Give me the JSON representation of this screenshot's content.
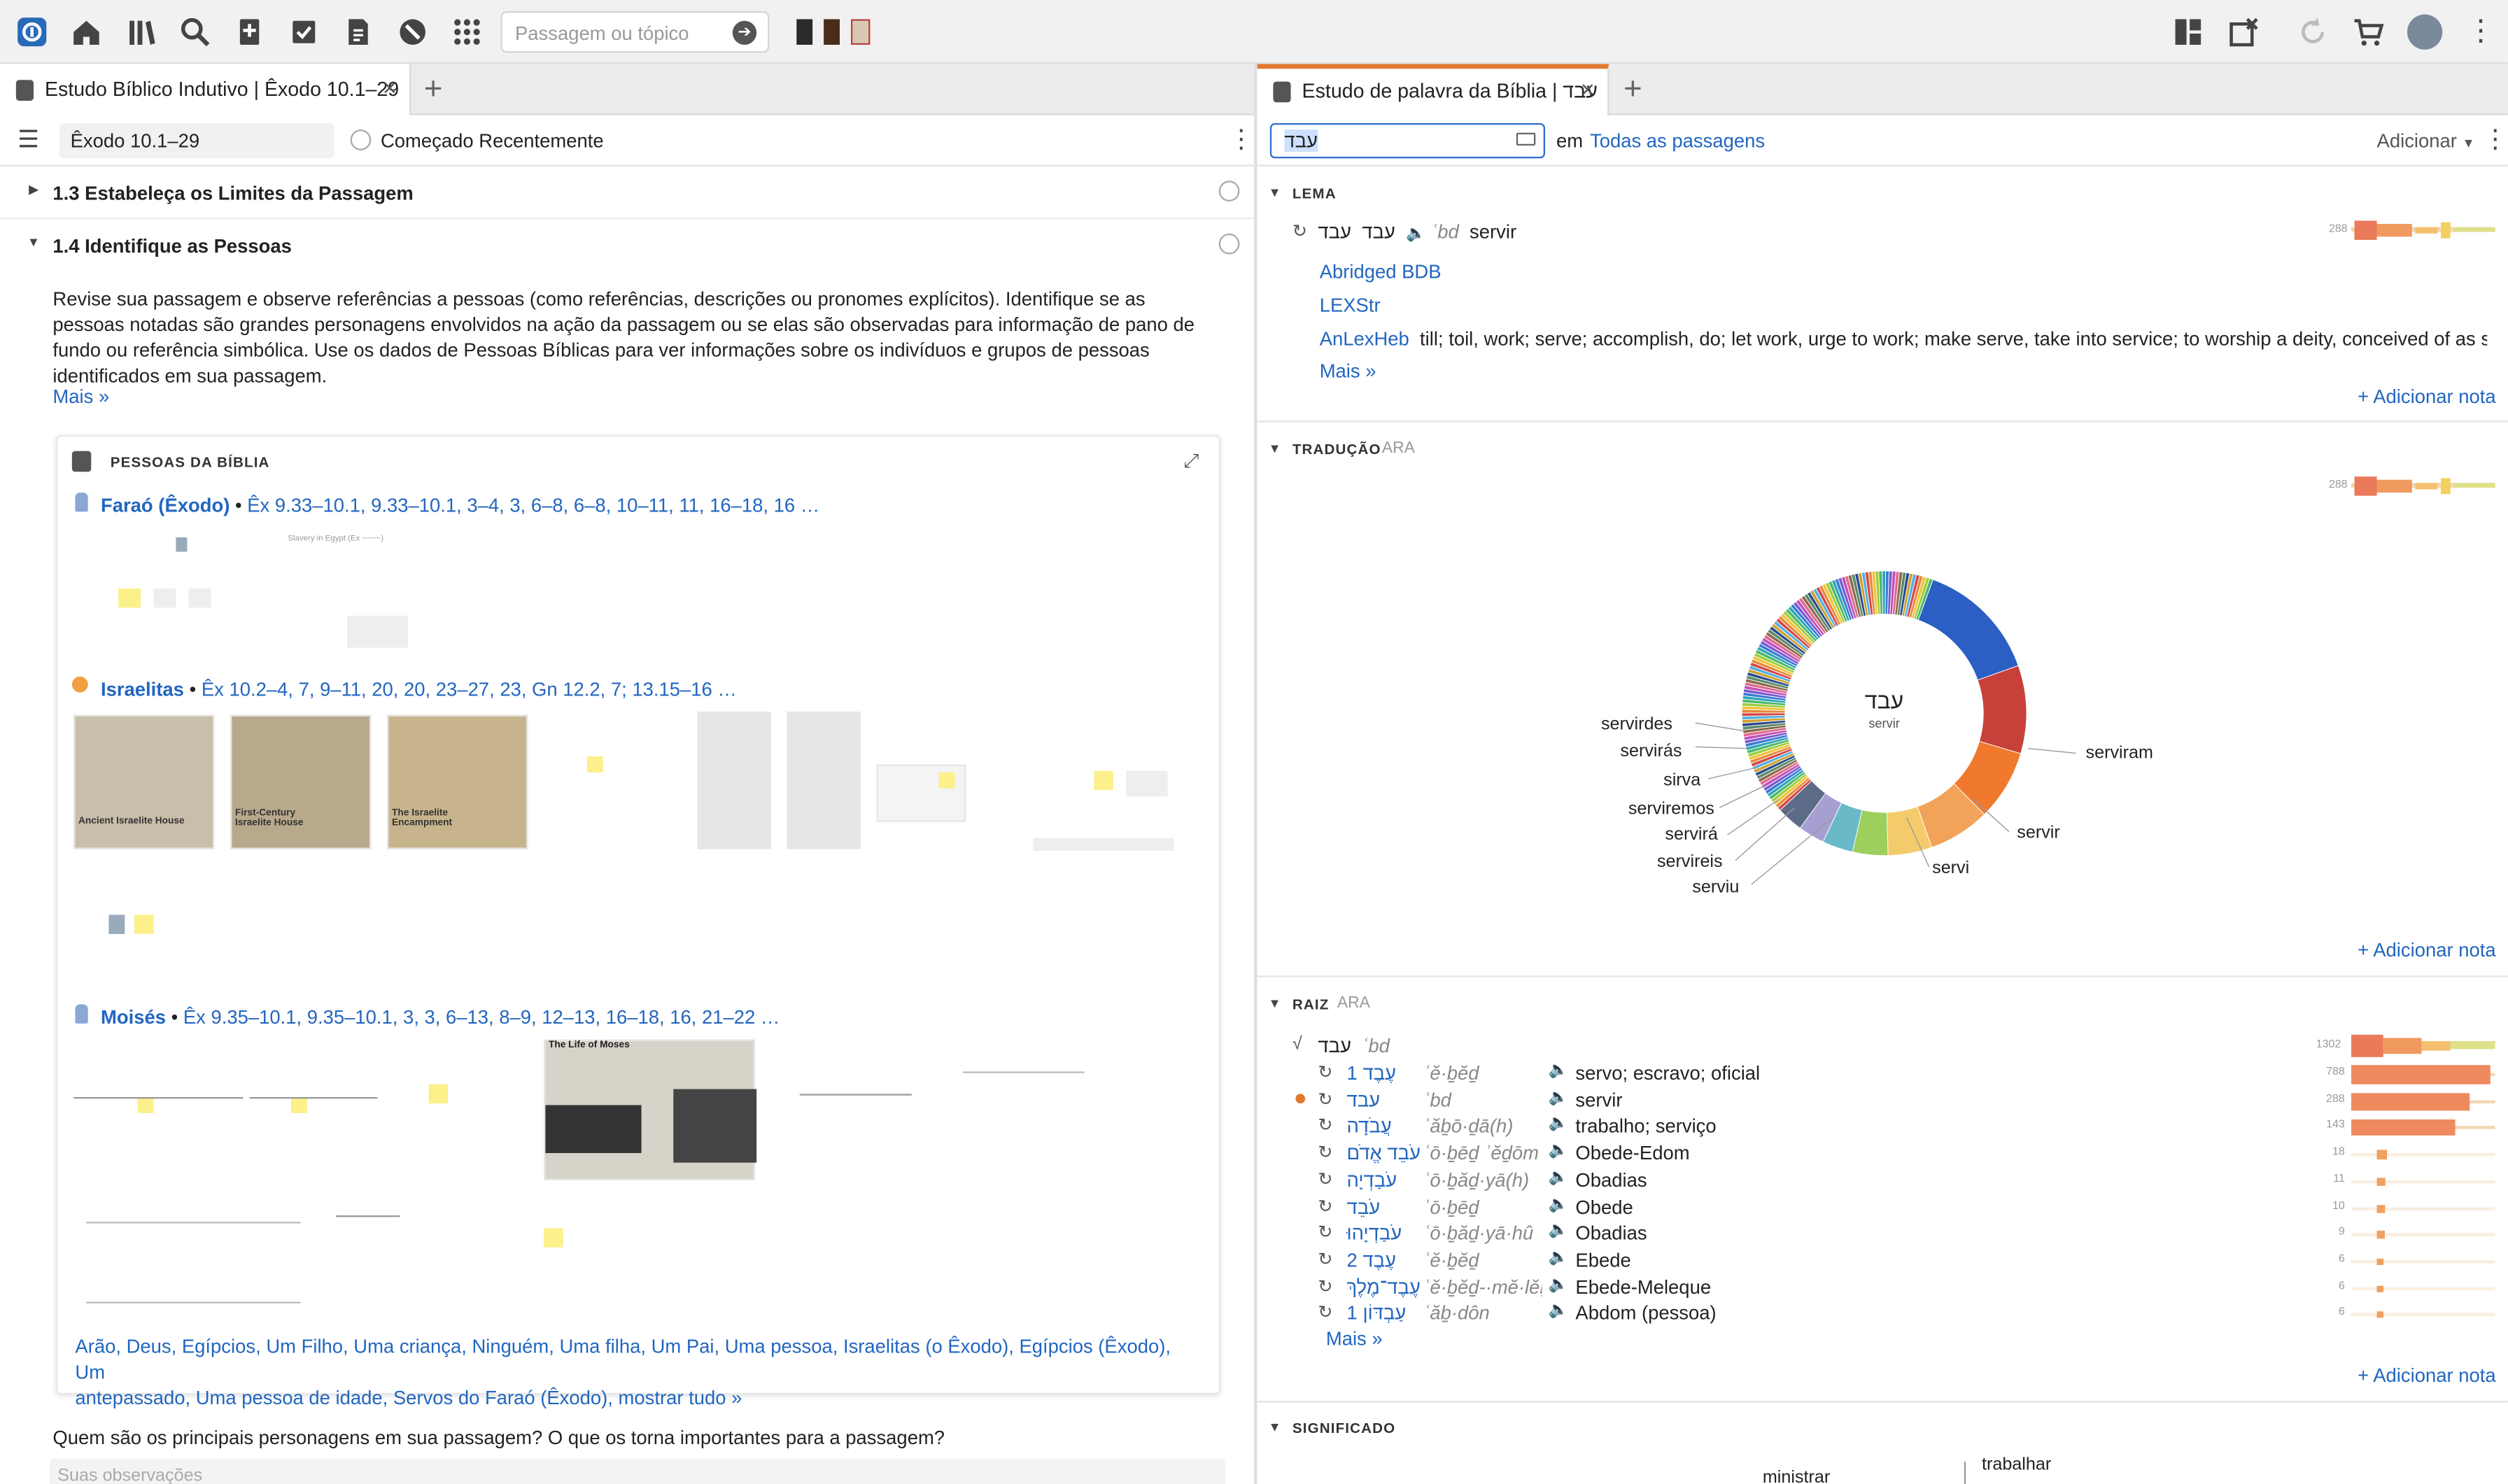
{
  "topbar": {
    "search_placeholder": "Passagem ou tópico"
  },
  "left": {
    "tab_title": "Estudo Bíblico Indutivo | Êxodo 10.1–29",
    "passage": "Êxodo 10.1–29",
    "status": "Começado Recentemente",
    "section_13": "1.3 Estabeleça os Limites da Passagem",
    "section_14": "1.4 Identifique as Pessoas",
    "instructions": "Revise sua passagem e observe referências a pessoas (como referências, descrições ou pronomes explícitos). Identifique se as pessoas notadas são grandes personagens envolvidos na ação da passagem ou se elas são observadas para informação de pano de fundo ou referência simbólica. Use os dados de Pessoas Bíblicas para ver informações sobre os indivíduos e grupos de pessoas identificados em sua passagem.",
    "more": "Mais »",
    "people_title": "PESSOAS DA BÍBLIA",
    "farao_name": "Faraó (Êxodo)",
    "farao_refs": "Êx 9.33–10.1, 9.33–10.1, 3–4, 3, 6–8, 6–8, 10–11, 11, 16–18, 16 …",
    "isr_name": "Israelitas",
    "isr_refs": "Êx 10.2–4, 7, 9–11, 20, 20, 23–27, 23, Gn 12.2, 7; 13.15–16 …",
    "mois_name": "Moisés",
    "mois_refs": "Êx 9.35–10.1, 9.35–10.1, 3, 3, 6–13, 8–9, 12–13, 16–18, 16, 21–22 …",
    "thumb_ancient": "Ancient Israelite House",
    "thumb_first": "First-Century Israelite House",
    "thumb_encamp": "The Israelite Encampment",
    "thumb_slavery": "Slavery in Egypt (Ex ~~~~)",
    "thumb_moses": "The Life of Moses",
    "people_list_1": "Arão, Deus, Egípcios, Um Filho, Uma criança, Ninguém, Uma filha, Um Pai, Uma pessoa, Israelitas (o Êxodo), Egípcios (Êxodo), Um",
    "people_list_2a": "antepassado, Uma pessoa de idade, Servos do Faraó (Êxodo), ",
    "people_list_2b": "mostrar tudo »",
    "question": "Quem são os principais personagens em sua passagem? O que os torna importantes para a passagem?",
    "observations_placeholder": "Suas observações"
  },
  "right": {
    "tab_title": "Estudo de palavra da Bíblia | עבד",
    "query": "עבד",
    "in_label": "em",
    "scope": "Todas as passagens",
    "add": "Adicionar",
    "lema_title": "LEMA",
    "lema_heb1": "עבד",
    "lema_heb2": "עבד",
    "lema_translit": "ʿbd",
    "lema_gloss": "servir",
    "lema_count": "288",
    "res_bdb": "Abridged BDB",
    "res_lexstr": "LEXStr",
    "res_anlex": "AnLexHeb",
    "anlex_def": "till; toil, work; serve; accomplish, do; let work, urge to work; make serve, take into service; to worship a deity, conceived of as servi…",
    "more": "Mais »",
    "add_note": "+ Adicionar nota",
    "trad_title": "TRADUÇÃO",
    "trad_version": "ARA",
    "trad_count": "288",
    "donut_center_word": "עבד",
    "donut_center_gloss": "servir",
    "labels": [
      "servirdes",
      "servirás",
      "sirva",
      "serviremos",
      "servirá",
      "servireis",
      "serviu",
      "servi",
      "servir",
      "serviram"
    ],
    "raiz_title": "RAIZ",
    "raiz_version": "ARA",
    "raiz_heb": "עבד",
    "raiz_translit": "ʿbd",
    "raiz_rows": [
      {
        "heb": "1 עֶבֶד",
        "tr": "ʿĕ·ḇĕḏ",
        "gloss": "servo; escravo; oficial",
        "count": "788"
      },
      {
        "heb": "עבד",
        "tr": "ʿbd",
        "gloss": "servir",
        "count": "288"
      },
      {
        "heb": "עֲבֹדָה",
        "tr": "ʿăḇō·ḏā(h)",
        "gloss": "trabalho; serviço",
        "count": "143"
      },
      {
        "heb": "עֹבֵד אֱדֹם",
        "tr": "ʿō·ḇēḏ ʾĕḏōm",
        "gloss": "Obede-Edom",
        "count": "18"
      },
      {
        "heb": "עֹבַדְיָה",
        "tr": "ʿō·ḇăḏ·yā(h)",
        "gloss": "Obadias",
        "count": "11"
      },
      {
        "heb": "עֹבֵד",
        "tr": "ʿō·ḇēḏ",
        "gloss": "Obede",
        "count": "10"
      },
      {
        "heb": "עֹבַדְיָהוּ",
        "tr": "ʿō·ḇăḏ·yā·hû",
        "gloss": "Obadias",
        "count": "9"
      },
      {
        "heb": "2 עֶבֶד",
        "tr": "ʿĕ·ḇĕḏ",
        "gloss": "Ebede",
        "count": "6"
      },
      {
        "heb": "עֶבֶד־מֶלֶךְ",
        "tr": "ʿĕ·ḇĕḏ-·mĕ·lĕḵ",
        "gloss": "Ebede-Meleque",
        "count": "6"
      },
      {
        "heb": "1 עַבְדּוֹן",
        "tr": "ʿăḇ·dôn",
        "gloss": "Abdom (pessoa)",
        "count": "6"
      }
    ],
    "raiz_total": "1302",
    "sig_title": "SIGNIFICADO",
    "sig_word1": "ministrar",
    "sig_word2": "trabalhar"
  }
}
